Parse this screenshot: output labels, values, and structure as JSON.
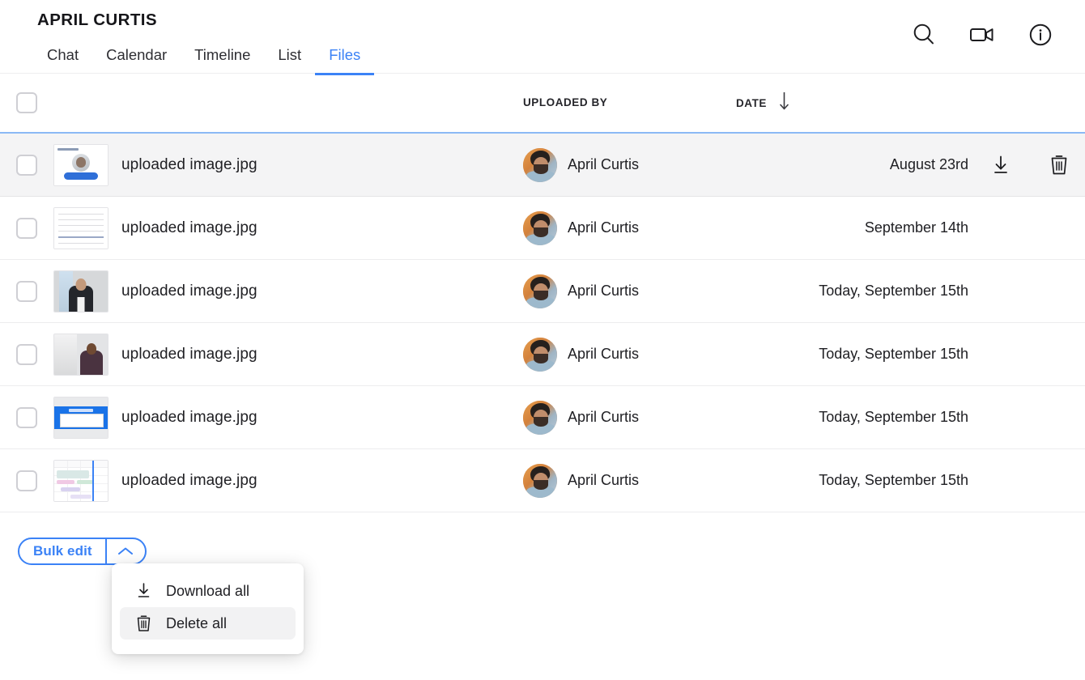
{
  "header": {
    "title": "APRIL CURTIS",
    "tabs": [
      {
        "label": "Chat",
        "active": false
      },
      {
        "label": "Calendar",
        "active": false
      },
      {
        "label": "Timeline",
        "active": false
      },
      {
        "label": "List",
        "active": false
      },
      {
        "label": "Files",
        "active": true
      }
    ],
    "icons": [
      {
        "name": "search-icon",
        "label": "Search"
      },
      {
        "name": "video-camera-icon",
        "label": "Video call"
      },
      {
        "name": "info-icon",
        "label": "Info"
      }
    ]
  },
  "table": {
    "columns": {
      "select": "",
      "thumbnail": "",
      "name": "",
      "uploaded_by": "UPLOADED BY",
      "date": "DATE",
      "actions": ""
    },
    "sort": {
      "column": "DATE",
      "direction": "down",
      "icon": "arrow-down-icon"
    },
    "rows": [
      {
        "filename": "uploaded image.jpg",
        "uploader": "April Curtis",
        "date": "August 23rd",
        "thumb": "profile-card",
        "hovered": true,
        "actions": [
          {
            "name": "download-icon",
            "label": "Download"
          },
          {
            "name": "trash-icon",
            "label": "Delete"
          }
        ]
      },
      {
        "filename": "uploaded image.jpg",
        "uploader": "April Curtis",
        "date": "September 14th",
        "thumb": "document",
        "hovered": false,
        "actions": []
      },
      {
        "filename": "uploaded image.jpg",
        "uploader": "April Curtis",
        "date": "Today, September 15th",
        "thumb": "portrait-glasses",
        "hovered": false,
        "actions": []
      },
      {
        "filename": "uploaded image.jpg",
        "uploader": "April Curtis",
        "date": "Today, September 15th",
        "thumb": "portrait-suit",
        "hovered": false,
        "actions": []
      },
      {
        "filename": "uploaded image.jpg",
        "uploader": "April Curtis",
        "date": "Today, September 15th",
        "thumb": "blue-banner",
        "hovered": false,
        "actions": []
      },
      {
        "filename": "uploaded image.jpg",
        "uploader": "April Curtis",
        "date": "Today, September 15th",
        "thumb": "gantt-calendar",
        "hovered": false,
        "actions": []
      }
    ]
  },
  "bulk_edit": {
    "label": "Bulk edit",
    "caret_icon": "chevron-up-icon",
    "menu": {
      "open": true,
      "items": [
        {
          "label": "Download all",
          "icon": "download-icon",
          "highlighted": false
        },
        {
          "label": "Delete all",
          "icon": "trash-icon",
          "highlighted": true
        }
      ]
    }
  },
  "colors": {
    "accent": "#3b82f6",
    "row_hover_bg": "#f4f4f5",
    "menu_highlight_bg": "#f2f2f3",
    "text": "#202024",
    "border": "#ececee"
  }
}
